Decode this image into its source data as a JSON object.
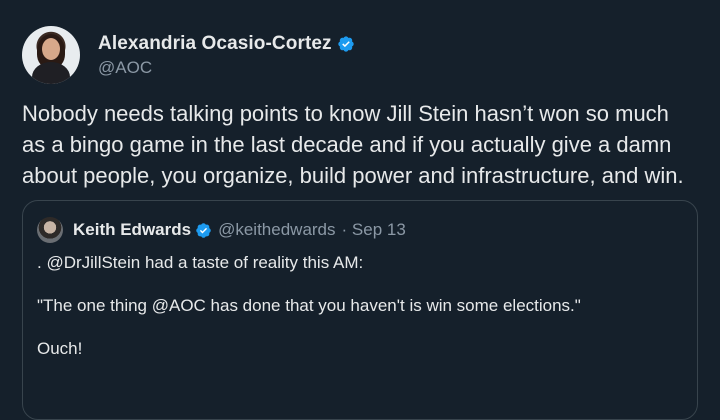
{
  "tweet": {
    "author": {
      "display_name": "Alexandria Ocasio-Cortez",
      "handle": "@AOC"
    },
    "text": "Nobody needs talking points to know Jill Stein hasn’t won so much as a bingo game in the last decade and if you actually give a damn about people, you organize, build power and infrastructure, and win."
  },
  "quoted_tweet": {
    "author": {
      "display_name": "Keith Edwards",
      "handle": "@keithedwards",
      "date": "· Sep 13"
    },
    "lines": [
      ". @DrJillStein had a taste of reality this AM:",
      "\"The one thing @AOC has done that you haven't is win some elections.\"",
      "Ouch!"
    ]
  },
  "colors": {
    "background": "#15202b",
    "verified": "#1d9bf0",
    "text": "#e7e9ea",
    "muted": "#8b98a5",
    "border": "#38444d"
  }
}
